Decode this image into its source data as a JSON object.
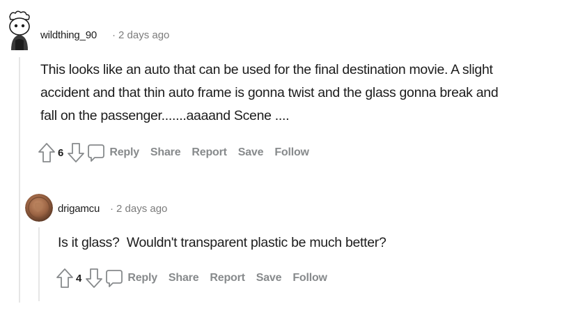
{
  "comments": [
    {
      "username": "wildthing_90",
      "separator": "·",
      "time": "2 days ago",
      "body_lines": [
        "This looks like an auto that can be used for the final destination movie. A slight",
        "accident and that thin auto frame is gonna twist and the glass gonna break and",
        "fall on the passenger.......aaaand Scene ...."
      ],
      "votes": "6",
      "actions": {
        "reply": "Reply",
        "share": "Share",
        "report": "Report",
        "save": "Save",
        "follow": "Follow"
      }
    },
    {
      "username": "drigamcu",
      "separator": "·",
      "time": "2 days ago",
      "body_lines": [
        "Is it glass?  Wouldn't transparent plastic be much better?"
      ],
      "votes": "4",
      "actions": {
        "reply": "Reply",
        "share": "Share",
        "report": "Report",
        "save": "Save",
        "follow": "Follow"
      }
    }
  ],
  "icons": {
    "upvote": "upvote-arrow-icon",
    "downvote": "downvote-arrow-icon",
    "reply": "comment-bubble-icon",
    "avatar1": "snoo-avatar-icon",
    "avatar2": "user-avatar-photo"
  },
  "colors": {
    "text": "#1c1c1c",
    "meta": "#7c7c7c",
    "action": "#878a8c",
    "thread_line": "#e6e6e6"
  }
}
